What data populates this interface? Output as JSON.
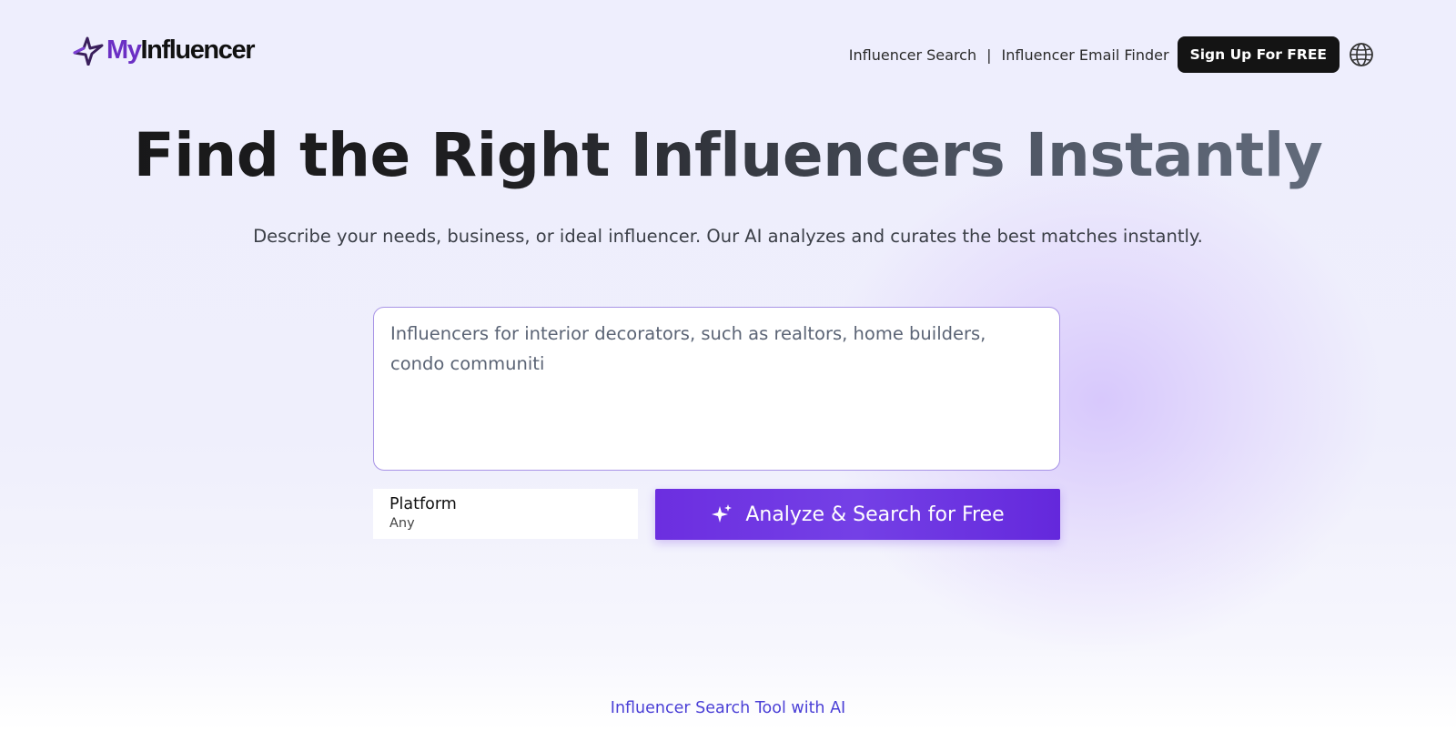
{
  "header": {
    "logo": {
      "prefix": "My",
      "suffix": "Influencer"
    },
    "nav": {
      "link1": "Influencer Search",
      "separator": "|",
      "link2": "Influencer Email Finder",
      "signup": "Sign Up For FREE",
      "language_icon": "globe-icon"
    }
  },
  "hero": {
    "headline": "Find the Right Influencers Instantly",
    "subtitle": "Describe your needs, business, or ideal influencer. Our AI analyzes and curates the best matches instantly."
  },
  "search": {
    "value": "Influencers for interior decorators, such as realtors, home builders, condo communiti",
    "platform_label": "Platform",
    "platform_value": "Any",
    "button_label": "Analyze & Search for Free",
    "button_icon": "sparkle-icon"
  },
  "footer": {
    "link": "Influencer Search Tool with AI"
  },
  "colors": {
    "accent": "#6c2ee0",
    "logo_purple": "#6b2fc4",
    "signup_bg": "#141414",
    "footer_link": "#4a3fd6",
    "input_border": "#a894e6"
  }
}
